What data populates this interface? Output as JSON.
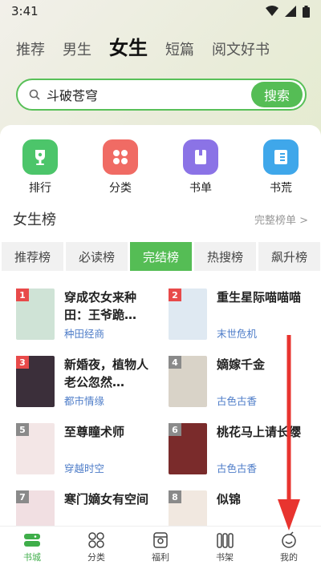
{
  "status": {
    "time": "3:41"
  },
  "top_tabs": [
    "推荐",
    "男生",
    "女生",
    "短篇",
    "阅文好书"
  ],
  "active_top_tab": 2,
  "search": {
    "query": "斗破苍穹",
    "button": "搜索"
  },
  "quick_links": [
    {
      "label": "排行",
      "icon": "trophy-icon",
      "color": "#4cc56a"
    },
    {
      "label": "分类",
      "icon": "grid-icon",
      "color": "#f06b64"
    },
    {
      "label": "书单",
      "icon": "book-icon",
      "color": "#8b73e6"
    },
    {
      "label": "书荒",
      "icon": "list-icon",
      "color": "#3fa7ea"
    }
  ],
  "rank": {
    "title": "女生榜",
    "more": "完整榜单 >"
  },
  "rank_tabs": [
    "推荐榜",
    "必读榜",
    "完结榜",
    "热搜榜",
    "飙升榜"
  ],
  "active_rank_tab": 2,
  "books": [
    {
      "rank": "1",
      "title": "穿成农女来种田：王爷跪…",
      "genre": "种田经商",
      "badge_color": "#e84a4a",
      "cover_color": "#cfe3d6"
    },
    {
      "rank": "2",
      "title": "重生星际喵喵喵",
      "genre": "末世危机",
      "badge_color": "#e84a4a",
      "cover_color": "#dfe9f2"
    },
    {
      "rank": "3",
      "title": "新婚夜，植物人老公忽然…",
      "genre": "都市情缘",
      "badge_color": "#e84a4a",
      "cover_color": "#3b2f3a"
    },
    {
      "rank": "4",
      "title": "嫡嫁千金",
      "genre": "古色古香",
      "badge_color": "#8a8a8a",
      "cover_color": "#d9d3c8"
    },
    {
      "rank": "5",
      "title": "至尊瞳术师",
      "genre": "穿越时空",
      "badge_color": "#8a8a8a",
      "cover_color": "#f3e6e6"
    },
    {
      "rank": "6",
      "title": "桃花马上请长缨",
      "genre": "古色古香",
      "badge_color": "#8a8a8a",
      "cover_color": "#7a2b2b"
    },
    {
      "rank": "7",
      "title": "寒门嫡女有空间",
      "genre": "",
      "badge_color": "#8a8a8a",
      "cover_color": "#f1dfe2"
    },
    {
      "rank": "8",
      "title": "似锦",
      "genre": "",
      "badge_color": "#8a8a8a",
      "cover_color": "#f1e8e0"
    }
  ],
  "bottom_nav": [
    {
      "label": "书城",
      "icon": "bookstore-icon"
    },
    {
      "label": "分类",
      "icon": "category-icon"
    },
    {
      "label": "福利",
      "icon": "gift-icon"
    },
    {
      "label": "书架",
      "icon": "bookshelf-icon"
    },
    {
      "label": "我的",
      "icon": "profile-icon"
    }
  ],
  "active_nav": 0,
  "accent_color": "#55bd55"
}
